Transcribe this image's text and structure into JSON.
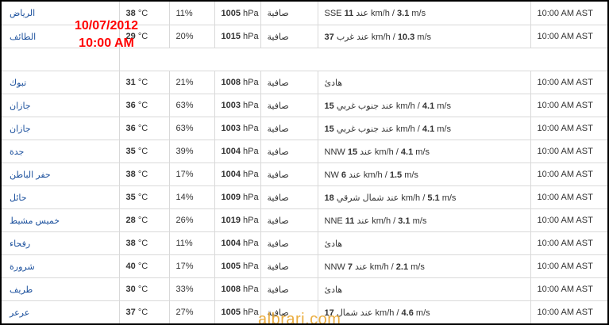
{
  "overlay": {
    "date": "10/07/2012",
    "time": "10:00 AM"
  },
  "watermark": {
    "text": "albrari.com"
  },
  "temp_unit": "°C",
  "pressure_unit": "hPa",
  "wind_speed_unit": "km/h",
  "wind_ms_unit": "m/s",
  "direction_prefix": "عند",
  "top_rows": [
    {
      "city": "الرياض",
      "temp": "38",
      "humidity": "11%",
      "pressure": "1005",
      "condition": "صافية",
      "wind_dir": "SSE",
      "wind_kmh": "11",
      "wind_ms": "3.1",
      "time": "10:00 AM AST"
    },
    {
      "city": "الطائف",
      "temp": "29",
      "humidity": "20%",
      "pressure": "1015",
      "condition": "صافية",
      "wind_dir": "غرب",
      "wind_kmh": "37",
      "wind_ms": "10.3",
      "time": "10:00 AM AST"
    }
  ],
  "rows": [
    {
      "city": "تبوك",
      "temp": "31",
      "humidity": "21%",
      "pressure": "1008",
      "condition": "صافية",
      "wind_text": "هادئ",
      "time": "10:00 AM AST"
    },
    {
      "city": "جازان",
      "temp": "36",
      "humidity": "63%",
      "pressure": "1003",
      "condition": "صافية",
      "wind_dir": "جنوب غربي",
      "wind_kmh": "15",
      "wind_ms": "4.1",
      "time": "10:00 AM AST"
    },
    {
      "city": "جازان",
      "temp": "36",
      "humidity": "63%",
      "pressure": "1003",
      "condition": "صافية",
      "wind_dir": "جنوب غربي",
      "wind_kmh": "15",
      "wind_ms": "4.1",
      "time": "10:00 AM AST"
    },
    {
      "city": "جدة",
      "temp": "35",
      "humidity": "39%",
      "pressure": "1004",
      "condition": "صافية",
      "wind_dir": "NNW",
      "wind_kmh": "15",
      "wind_ms": "4.1",
      "time": "10:00 AM AST"
    },
    {
      "city": "حفر الباطن",
      "temp": "38",
      "humidity": "17%",
      "pressure": "1004",
      "condition": "صافية",
      "wind_dir": "NW",
      "wind_kmh": "6",
      "wind_ms": "1.5",
      "time": "10:00 AM AST"
    },
    {
      "city": "حائل",
      "temp": "35",
      "humidity": "14%",
      "pressure": "1009",
      "condition": "صافية",
      "wind_dir": "شمال شرقي",
      "wind_kmh": "18",
      "wind_ms": "5.1",
      "time": "10:00 AM AST"
    },
    {
      "city": "خميس مشيط",
      "temp": "28",
      "humidity": "26%",
      "pressure": "1019",
      "condition": "صافية",
      "wind_dir": "NNE",
      "wind_kmh": "11",
      "wind_ms": "3.1",
      "time": "10:00 AM AST"
    },
    {
      "city": "رفحاء",
      "temp": "38",
      "humidity": "11%",
      "pressure": "1004",
      "condition": "صافية",
      "wind_text": "هادئ",
      "time": "10:00 AM AST"
    },
    {
      "city": "شرورة",
      "temp": "40",
      "humidity": "17%",
      "pressure": "1005",
      "condition": "صافية",
      "wind_dir": "NNW",
      "wind_kmh": "7",
      "wind_ms": "2.1",
      "time": "10:00 AM AST"
    },
    {
      "city": "طريف",
      "temp": "30",
      "humidity": "33%",
      "pressure": "1008",
      "condition": "صافية",
      "wind_text": "هادئ",
      "time": "10:00 AM AST"
    },
    {
      "city": "عرعر",
      "temp": "37",
      "humidity": "27%",
      "pressure": "1005",
      "condition": "صافية",
      "wind_dir": "شمال",
      "wind_kmh": "17",
      "wind_ms": "4.6",
      "time": "10:00 AM AST"
    }
  ]
}
